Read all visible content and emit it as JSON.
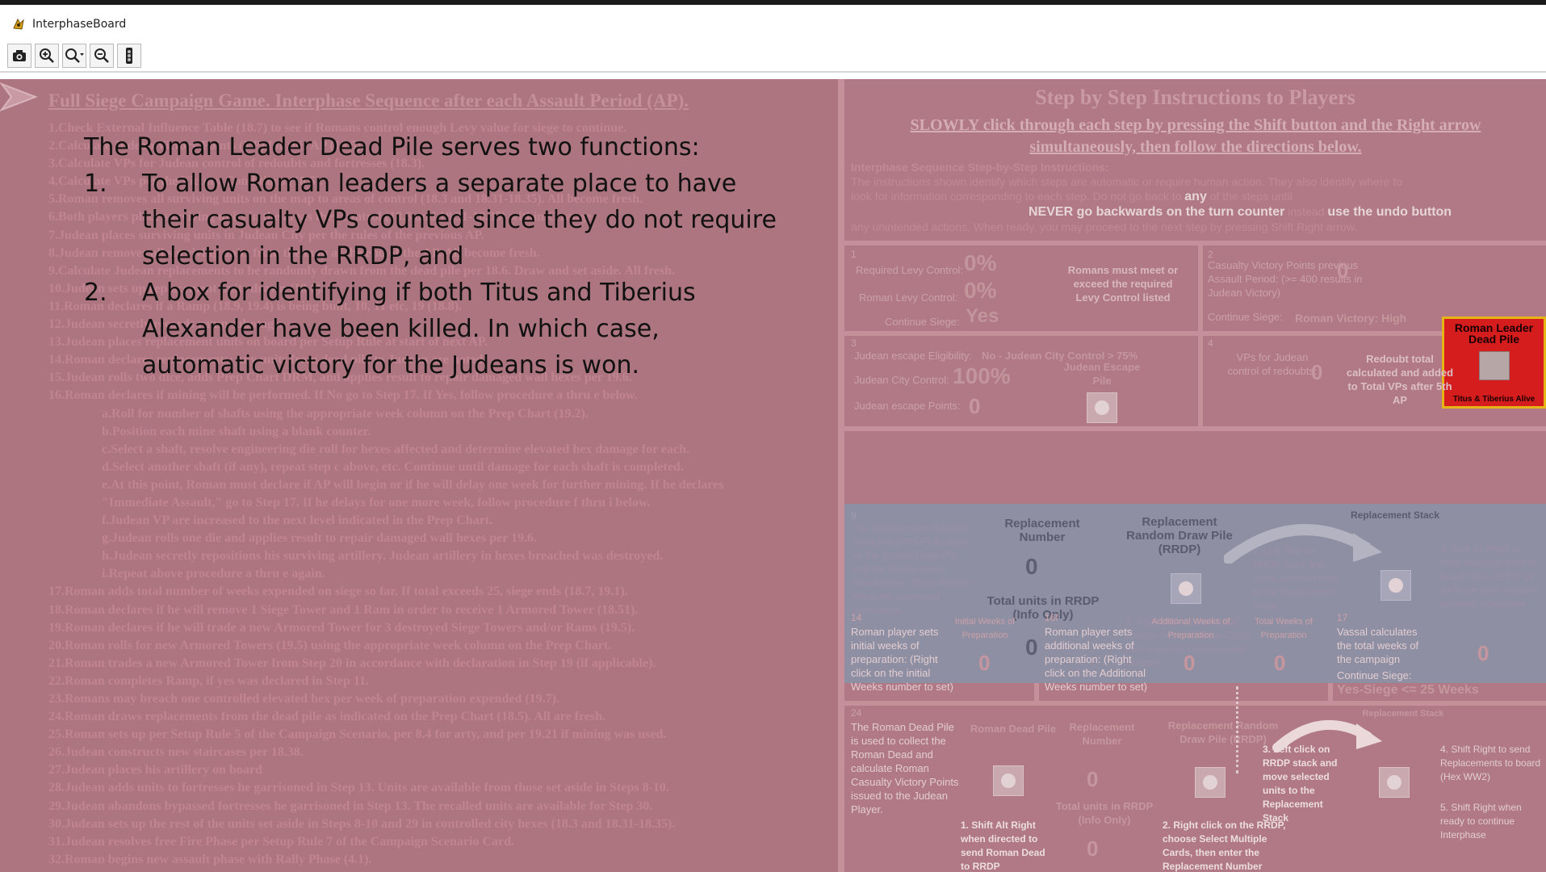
{
  "window": {
    "title": "InterphaseBoard"
  },
  "toolbar": {
    "buttons": [
      {
        "icon": "camera-icon"
      },
      {
        "icon": "zoom-in-icon"
      },
      {
        "icon": "zoom-select-icon"
      },
      {
        "icon": "zoom-out-icon"
      },
      {
        "icon": "traffic-light-icon"
      }
    ]
  },
  "board": {
    "left_title": "Full Siege Campaign Game. Interphase Sequence after each Assault Period (AP).",
    "steps": [
      "1.Check External Influence Table (18.7) to see if Romans control enough Levy value for siege to continue.",
      "2.Calculate Judean Victory Points (VP) for this AP (18.5).",
      "3.Calculate VPs for Judean control of redoubts and fortresses (18.3).",
      "4.Calculate VPs per the Victory Conditions (18.5).",
      "5.Roman removes all surviving units on the map to areas of control (18.3 and 18.31-18.35). All become fresh.",
      "6.Both players place surviving units in the areas they control (18.3 and 18.31-18.35) within C range.",
      "7.Judean places surviving units in Judean City per the rules of the previous AP.",
      "8.Judean removes all surviving units from the map at the end of the AP. All become fresh.",
      "9.Calculate Judean replacements to be randomly drawn from the dead pile per 18.6. Draw and set aside. All fresh.",
      "10.Judean sets up replacement units drawn (18.6).",
      "11.Roman declares if a Ramp (18.9, 19.4) is being built, 10, 11 etc, 19 (18.8).",
      "12.Judean secretly records ramp sabotage.",
      "13.Judean places replacement units on board per Setup Rule at start of next AP.",
      "14.Roman declares replacements; any units from dead pile to Judean are noted.",
      "15.Judean rolls two dice, adds Prep Chart DRM, and applies result to repair damaged wall hexes per 19.6.",
      "16.Roman declares if mining will be performed. If No go to Step 17. If Yes, follow procedure a thru e below."
    ],
    "sub_steps": [
      "a.Roll for number of shafts using the appropriate week column on the Prep Chart (19.2).",
      "b.Position each mine shaft using a blank counter.",
      "c.Select a shaft, resolve engineering die roll for hexes affected and determine elevated hex damage for each.",
      "d.Select another shaft (if any), repeat step c above, etc. Continue until damage for each shaft is completed.",
      "e.At this point, Roman must declare if AP will begin or if he will delay one week for further mining. If he declares",
      "\"Immediate Assault,\" go to Step 17. If he delays for one more week, follow procedure f thru i below.",
      "f.Judean VP are increased to the next level indicated in the Prep Chart.",
      "g.Judean rolls one die and applies result to repair damaged wall hexes per 19.6.",
      "h.Judean secretly repositions his surviving artillery. Judean artillery in hexes breached was destroyed.",
      "i.Repeat above procedure a thru e again."
    ],
    "steps_after": [
      "17.Roman adds total number of weeks expended on siege so far. If total exceeds 25, siege ends (18.7, 19.1).",
      "18.Roman declares if he will remove 1 Siege Tower and 1 Ram in order to receive 1 Armored Tower (18.51).",
      "19.Roman declares if he will trade a new Armored Tower for 3 destroyed Siege Towers and/or Rams (19.5).",
      "20.Roman rolls for new Armored Towers (19.5) using the appropriate week column on the Prep Chart.",
      "21.Roman trades a new Armored Tower from Step 20 in accordance with declaration in Step 19 (if applicable).",
      "22.Roman completes Ramp, if yes was declared in Step 11.",
      "23.Romans may breach one controlled elevated hex per week of preparation expended (19.7).",
      "24.Roman draws replacements from the dead pile as indicated on the Prep Chart (18.5). All are fresh.",
      "25.Roman sets up per Setup Rule 5 of the Campaign Scenario, per 8.4 for arty, and per 19.21 if mining was used.",
      "26.Judean constructs new staircases per 18.38.",
      "27.Judean places his artillery on board",
      "28.Judean adds units to fortresses he garrisoned in Step 13. Units are available from those set aside in Steps 8-10.",
      "29.Judean abandons bypassed fortresses he garrisoned in Step 13. The recalled units are available for Step 30.",
      "30.Judean sets up the rest of the units set aside in Steps 8-10 and 29 in controlled city hexes (18.3 and 18.31-18.35).",
      "31.Judean resolves free Fire Phase per Setup Rule 7 of the Campaign Scenario Card.",
      "32.Roman begins new assault phase with Rally Phase (4.1)."
    ],
    "right_heading": "Step by Step Instructions to Players",
    "right_sub": "SLOWLY click through each step by pressing the Shift button and the Right arrow simultaneously, then follow the directions below.",
    "intro_title": "Interphase Sequence Step-by-Step Instructions:",
    "intro_line1": "The instructions shown identify which steps are automatic or require human action. They also identify where to",
    "intro_line2": "look for information corresponding to each step.",
    "intro_dont": "Do not go back to",
    "intro_any": "any",
    "intro_rest": "of the steps until",
    "intro_never": "NEVER go backwards on the turn counter",
    "intro_instead": "instead",
    "intro_undo": "use the undo button",
    "intro_line4": "any unintended actions. When ready, you may proceed to the next step by pressing Shift Right arrow.",
    "cell1": {
      "num": "1",
      "required_label": "Required Levy Control:",
      "required_value": "0%",
      "roman_label": "Roman Levy Control:",
      "roman_value": "0%",
      "continue_label": "Continue Siege:",
      "continue_value": "Yes",
      "note": "Romans must meet or exceed the required Levy Control listed"
    },
    "cell2": {
      "num": "2",
      "label": "Casualty Victory Points previous Assault Period: (>= 400 results in Judean Victory)",
      "value": "0",
      "continue_label": "Continue Siege:",
      "continue_value": "Roman Victory: High"
    },
    "cell3": {
      "num": "3",
      "elig_label": "Judean escape Eligibility:",
      "elig_value": "No - Judean City Control > 75%",
      "city_label": "Judean City Control:",
      "city_value": "100%",
      "escape_pile": "Judean Escape Pile",
      "points_label": "Judean escape Points:",
      "points_value": "0"
    },
    "cell4": {
      "num": "4",
      "label": "VPs for Judean control of redoubts:",
      "value": "0",
      "note": "Redoubt total calculated and added to Total VPs after 5th AP"
    },
    "dead_pile": {
      "title": "Roman Leader Dead Pile",
      "footer": "Titus & Tiberius Alive"
    },
    "replacement": {
      "num": "9",
      "desc": "The Replacement Random Draw Pile (RRDP) doubles as the Judean Dead Pile and the Replacement Randomizer. When directed follow the numbered instructions",
      "number_label": "Replacement Number",
      "number_value": "0",
      "rrdp_label": "Replacement Random Draw Pile (RRDP)",
      "stack_label": "Replacement Stack",
      "total_label": "Total units in RRDP (Info Only)",
      "total_value": "0",
      "step2": "2. Left click on RRDP stack and move selected units to the Replacement Stack",
      "step3": "3. Right click on the RRDP, choose Select Multiple Cards, then enter the Replacement Number",
      "step4": "4. Shift Alt Right to send Replacements to board (Hex 1E/1F) Or Alt Right when ready to continue Interphase"
    },
    "row14": {
      "num14": "14",
      "text14": "Roman player sets initial weeks of preparation: (Right click on the initial Weeks number to set)",
      "label14": "Initial Weeks of Preparation",
      "value14": "0",
      "num16": "16f",
      "text16": "Roman player sets additional weeks of preparation: (Right click on the Additional Weeks number to set)",
      "label16": "Additional Weeks of Preparation",
      "value16": "0",
      "label16b": "Total Weeks of Preparation",
      "value16b": "0",
      "num17": "17",
      "text17": "Vassal calculates the total weeks of the campaign",
      "continue_label": "Continue Siege:",
      "continue_value": "Yes-Siege <= 25 Weeks",
      "value17": "0"
    },
    "row24": {
      "num": "24",
      "desc": "The Roman Dead Pile is used to collect the Roman Dead and calculate Roman Casualty Victory Points issued to the Judean Player.",
      "dead_label": "Roman Dead Pile",
      "number_label": "Replacement Number",
      "number_value": "0",
      "rrdp_label": "Replacement Random Draw Pile (RRDP)",
      "stack_label": "Replacement Stack",
      "total_label": "Total units in RRDP (Info Only)",
      "total_value": "0",
      "step1": "1. Shift Alt Right when directed to send Roman Dead to RRDP",
      "step2": "2. Right click on the RRDP, choose Select Multiple Cards, then enter the Replacement Number",
      "step3": "3. Left click on RRDP stack and move selected units to the Replacement Stack",
      "step4": "4. Shift Right to send Replacements to board (Hex WW2)",
      "step5": "5. Shift Right when ready to continue Interphase"
    }
  },
  "callout": {
    "intro": "The Roman Leader Dead Pile serves two functions:",
    "items": [
      {
        "num": "1.",
        "text": "To allow Roman leaders a separate place to have their casualty VPs counted since they do not require selection in the RRDP, and"
      },
      {
        "num": "2.",
        "text": "A box for identifying if both Titus and Tiberius Alexander have been killed. In which case, automatic victory for the Judeans is won."
      }
    ]
  },
  "colors": {
    "board": "#ad7580",
    "replacement_panel": "#8f8fa3",
    "dead_pile_red": "#d51d1d",
    "dead_pile_border": "#e6b416"
  }
}
